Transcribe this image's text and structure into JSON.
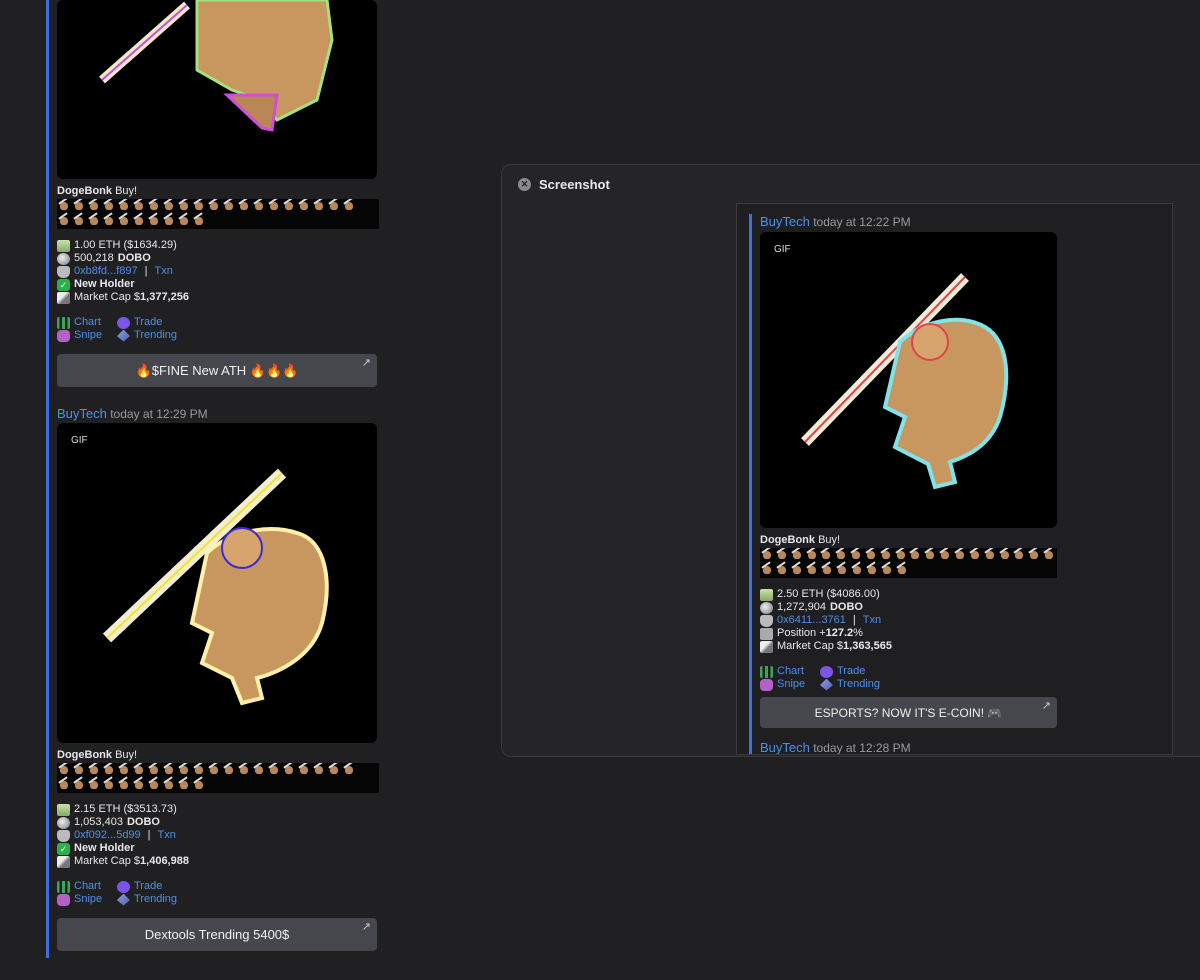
{
  "feed": {
    "post1": {
      "title_name": "DogeBonk",
      "title_suffix": "Buy!",
      "eth": "1.00 ETH ($1634.29)",
      "tokens": "500,218",
      "token_symbol": "DOBO",
      "wallet": "0xb8fd...f897",
      "txn": "Txn",
      "holder": "New Holder",
      "mcap_prefix": "Market Cap $",
      "mcap_value": "1,377,256",
      "chart": "Chart",
      "trade": "Trade",
      "snipe": "Snipe",
      "trending": "Trending",
      "button": "$FINE New ATH"
    },
    "meta2": {
      "who": "BuyTech",
      "time": "today at 12:29 PM"
    },
    "post2": {
      "gif": "GIF",
      "title_name": "DogeBonk",
      "title_suffix": "Buy!",
      "eth": "2.15 ETH ($3513.73)",
      "tokens": "1,053,403",
      "token_symbol": "DOBO",
      "wallet": "0xf092...5d99",
      "txn": "Txn",
      "holder": "New Holder",
      "mcap_prefix": "Market Cap $",
      "mcap_value": "1,406,988",
      "chart": "Chart",
      "trade": "Trade",
      "snipe": "Snipe",
      "trending": "Trending",
      "button": "Dextools Trending 5400$"
    }
  },
  "modal": {
    "title": "Screenshot",
    "meta": {
      "who": "BuyTech",
      "time": "today at 12:22 PM"
    },
    "post": {
      "gif": "GIF",
      "title_name": "DogeBonk",
      "title_suffix": "Buy!",
      "eth": "2.50 ETH ($4086.00)",
      "tokens": "1,272,904",
      "token_symbol": "DOBO",
      "wallet": "0x6411...3761",
      "txn": "Txn",
      "position_prefix": "Position +",
      "position_value": "127.2",
      "position_suffix": "%",
      "mcap_prefix": "Market Cap $",
      "mcap_value": "1,363,565",
      "chart": "Chart",
      "trade": "Trade",
      "snipe": "Snipe",
      "trending": "Trending",
      "button": "ESPORTS? NOW IT'S E-COIN!"
    },
    "meta2": {
      "who": "BuyTech",
      "time": "today at 12:28 PM"
    }
  },
  "colors": {
    "accent": "#3d6fe0",
    "link": "#4f8fe7",
    "button": "#45474c",
    "background": "#202022"
  },
  "icons": [
    "cash-icon",
    "coin-icon",
    "hand-icon",
    "check-icon",
    "mountain-icon",
    "chart-icon",
    "alien-icon",
    "unicorn-icon",
    "ethereum-icon",
    "fire-icon",
    "close-icon",
    "external-arrow-icon",
    "gamepad-icon"
  ]
}
